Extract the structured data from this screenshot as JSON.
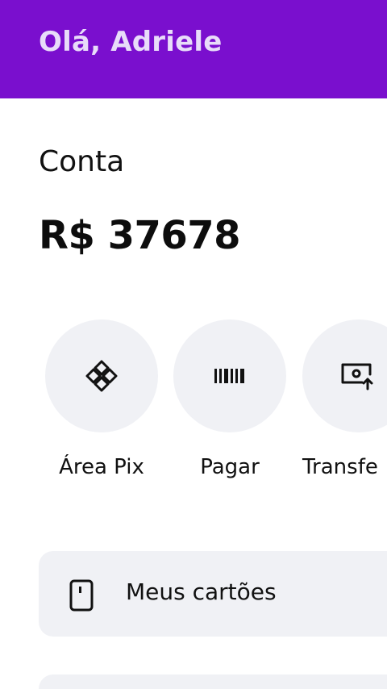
{
  "header": {
    "greeting": "Olá, Adriele",
    "background_color": "#7a0fce"
  },
  "account": {
    "title": "Conta",
    "balance": "R$ 37678"
  },
  "actions": [
    {
      "label": "Área Pix",
      "icon": "pix-icon"
    },
    {
      "label": "Pagar",
      "icon": "barcode-icon"
    },
    {
      "label": "Transfe",
      "icon": "transfer-icon"
    }
  ],
  "cards": {
    "label": "Meus cartões",
    "icon": "card-icon"
  }
}
